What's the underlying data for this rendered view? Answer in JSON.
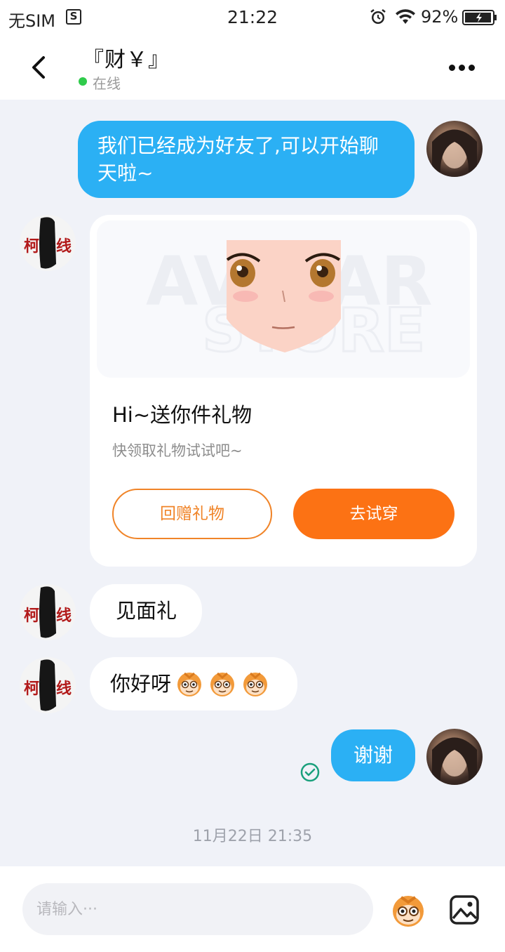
{
  "status_bar": {
    "carrier": "无SIM",
    "time": "21:22",
    "battery_percent": "92%"
  },
  "header": {
    "contact_name": "『财￥』",
    "status": "在线"
  },
  "messages": {
    "m1": "我们已经成为好友了,可以开始聊天啦~",
    "gift": {
      "title": "Hi~送你件礼物",
      "subtitle": "快领取礼物试试吧~",
      "return_label": "回赠礼物",
      "try_label": "去试穿"
    },
    "m3": "见面礼",
    "m4": "你好呀",
    "m5": "谢谢"
  },
  "timestamp": "11月22日 21:35",
  "input": {
    "placeholder": "请输入···"
  },
  "colors": {
    "bubble_blue": "#2bb0f4",
    "accent_orange": "#fc7214",
    "online_green": "#2fcb4b",
    "read_check": "#1aa07c"
  }
}
